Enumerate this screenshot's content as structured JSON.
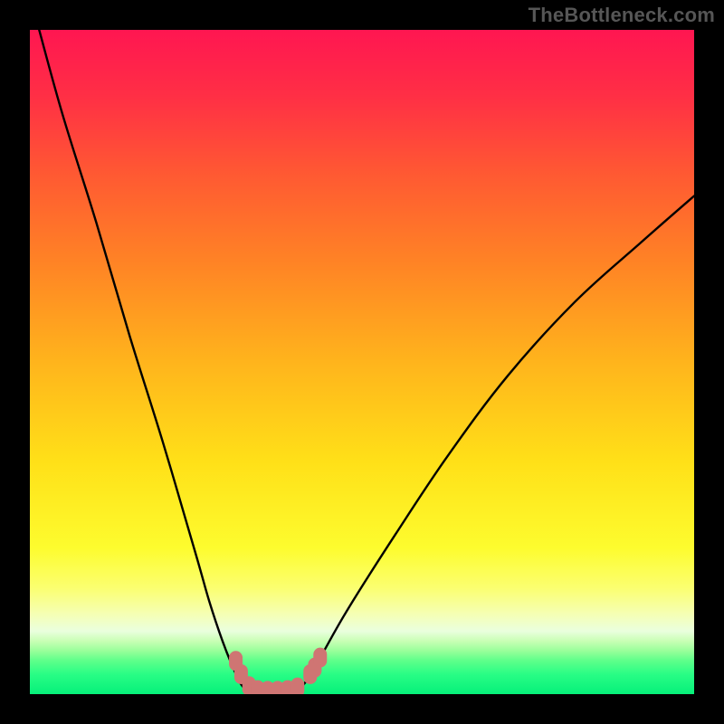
{
  "watermark": "TheBottleneck.com",
  "colors": {
    "frame": "#000000",
    "curve": "#000000",
    "marker": "#cf7573",
    "gradient_stops": [
      {
        "offset": 0.0,
        "color": "#ff1651"
      },
      {
        "offset": 0.1,
        "color": "#ff2f45"
      },
      {
        "offset": 0.22,
        "color": "#ff5a32"
      },
      {
        "offset": 0.35,
        "color": "#ff8325"
      },
      {
        "offset": 0.5,
        "color": "#ffb41c"
      },
      {
        "offset": 0.65,
        "color": "#ffe018"
      },
      {
        "offset": 0.78,
        "color": "#fdfc2e"
      },
      {
        "offset": 0.84,
        "color": "#fbff70"
      },
      {
        "offset": 0.88,
        "color": "#f5ffb5"
      },
      {
        "offset": 0.905,
        "color": "#eaffde"
      },
      {
        "offset": 0.92,
        "color": "#c9ffb5"
      },
      {
        "offset": 0.935,
        "color": "#98ff9a"
      },
      {
        "offset": 0.95,
        "color": "#5dff8a"
      },
      {
        "offset": 0.97,
        "color": "#29fd85"
      },
      {
        "offset": 1.0,
        "color": "#06f07a"
      }
    ]
  },
  "chart_data": {
    "type": "line",
    "title": "",
    "xlabel": "",
    "ylabel": "",
    "x_range": [
      0,
      100
    ],
    "y_range": [
      0,
      100
    ],
    "note": "Axes are normalized 0–100; values read from pixel positions inside the gradient plot area.",
    "series": [
      {
        "name": "bottleneck-curve-left",
        "x": [
          1.4,
          5,
          10,
          15,
          20,
          25,
          27,
          29,
          30.8,
          32,
          33.3
        ],
        "y": [
          100,
          87,
          71,
          54,
          38,
          21,
          14,
          8,
          3.5,
          1.2,
          0.5
        ]
      },
      {
        "name": "bottleneck-curve-flat",
        "x": [
          33.3,
          35,
          37,
          39,
          40.5
        ],
        "y": [
          0.5,
          0.3,
          0.3,
          0.4,
          0.8
        ]
      },
      {
        "name": "bottleneck-curve-right",
        "x": [
          40.5,
          42,
          44,
          48,
          55,
          63,
          72,
          82,
          92,
          100
        ],
        "y": [
          0.8,
          2.5,
          6,
          13,
          24,
          36,
          48,
          59,
          68,
          75
        ]
      }
    ],
    "markers": {
      "name": "highlighted-points",
      "points": [
        {
          "x": 31.0,
          "y": 5.0
        },
        {
          "x": 31.8,
          "y": 3.0
        },
        {
          "x": 33.0,
          "y": 1.2
        },
        {
          "x": 34.3,
          "y": 0.6
        },
        {
          "x": 35.8,
          "y": 0.5
        },
        {
          "x": 37.3,
          "y": 0.5
        },
        {
          "x": 38.8,
          "y": 0.6
        },
        {
          "x": 40.3,
          "y": 1.0
        },
        {
          "x": 42.2,
          "y": 3.0
        },
        {
          "x": 42.9,
          "y": 4.0
        },
        {
          "x": 43.7,
          "y": 5.5
        }
      ]
    }
  }
}
